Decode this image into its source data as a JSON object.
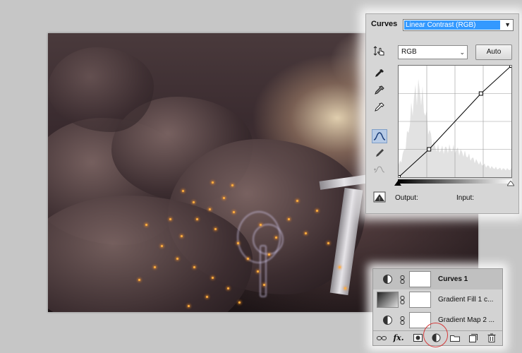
{
  "curves_panel": {
    "title": "Curves",
    "preset_value": "Linear Contrast (RGB)",
    "channel_value": "RGB",
    "auto_label": "Auto",
    "output_label": "Output:",
    "input_label": "Input:",
    "curve_points": [
      [
        0,
        0
      ],
      [
        0.27,
        0.25
      ],
      [
        0.73,
        0.75
      ],
      [
        1,
        1
      ]
    ]
  },
  "layers_panel": {
    "layers": [
      {
        "name": "Curves 1",
        "selected": true
      },
      {
        "name": "Gradient Fill 1 c...",
        "selected": false
      },
      {
        "name": "Gradient Map 2 ...",
        "selected": false
      }
    ],
    "footer_fx": "fx."
  },
  "colors": {
    "selection": "#3399ff",
    "highlight_circle": "#d43a3a",
    "spark": "#ffb040"
  }
}
